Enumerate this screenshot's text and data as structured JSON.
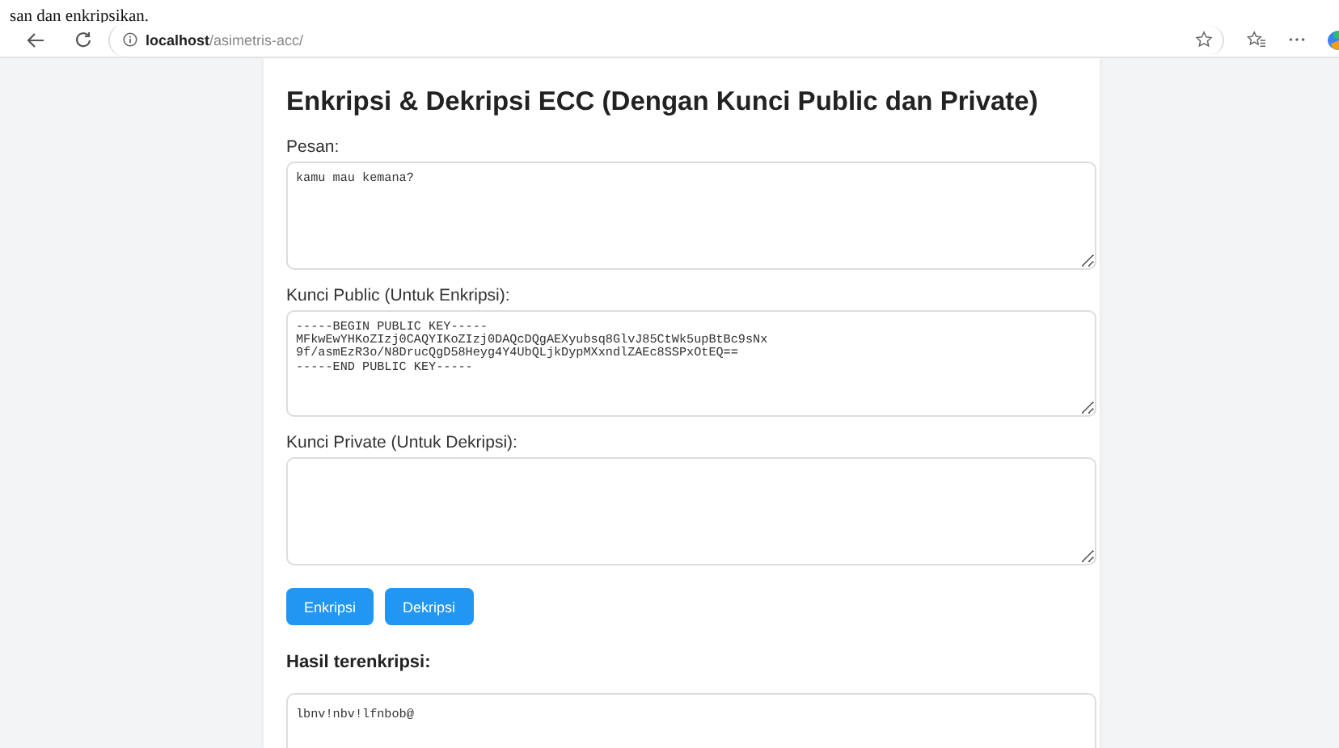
{
  "document_caption": "san dan enkripsikan.",
  "browser": {
    "url": "**localhost**/asimetris-acc/"
  },
  "page": {
    "title": "Enkripsi & Dekripsi ECC (Dengan Kunci Public dan Private)",
    "fields": [
      {
        "label": "Pesan:",
        "value": "kamu mau kemana?"
      },
      {
        "label": "Kunci Public (Untuk Enkripsi):",
        "value": "-----BEGIN PUBLIC KEY-----\nMFkwEwYHKoZIzj0CAQYIKoZIzj0DAQcDQgAEXyubsq8GlvJ85CtWk5upBtBc9sNx\n9f/asmEzR3o/N8DrucQgD58Heyg4Y4UbQLjkDypMXxndlZAEc8SSPxOtEQ==\n-----END PUBLIC KEY-----"
      },
      {
        "label": "Kunci Private (Untuk Dekripsi):"
      }
    ],
    "buttons": [
      "Enkripsi",
      "Dekripsi"
    ],
    "result": {
      "heading": "Hasil terenkripsi:",
      "value": "lbnv!nbv!lfnbob@"
    }
  }
}
